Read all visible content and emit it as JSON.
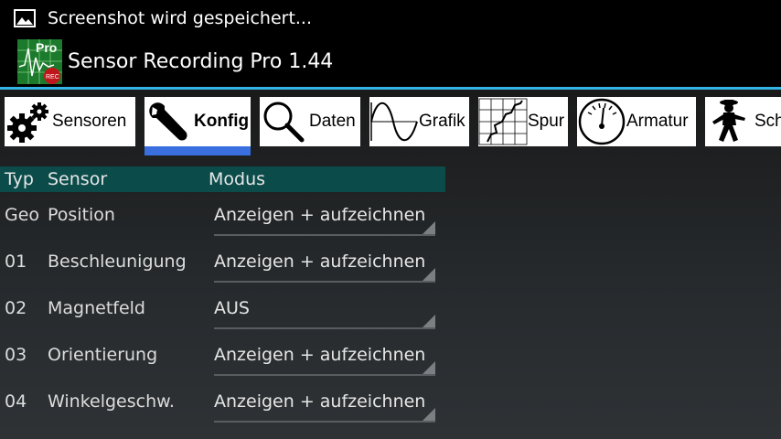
{
  "status_bar": {
    "notification": "Screenshot wird gespeichert..."
  },
  "app": {
    "title": "Sensor Recording Pro 1.44",
    "icon_text": "Pro",
    "icon_badge": "REC"
  },
  "tabs": [
    {
      "label": "Sensoren",
      "icon": "gears-icon"
    },
    {
      "label": "Konfig",
      "icon": "wrench-icon",
      "active": true
    },
    {
      "label": "Daten",
      "icon": "magnifier-icon"
    },
    {
      "label": "Grafik",
      "icon": "sine-wave-icon"
    },
    {
      "label": "Spur",
      "icon": "track-map-icon"
    },
    {
      "label": "Armatur",
      "icon": "gauge-icon"
    },
    {
      "label": "Sch",
      "icon": "walking-man-icon"
    }
  ],
  "table": {
    "headers": {
      "typ": "Typ",
      "sensor": "Sensor",
      "modus": "Modus"
    },
    "rows": [
      {
        "typ": "Geo",
        "sensor": "Position",
        "modus": "Anzeigen + aufzeichnen"
      },
      {
        "typ": "01",
        "sensor": "Beschleunigung",
        "modus": "Anzeigen + aufzeichnen"
      },
      {
        "typ": "02",
        "sensor": "Magnetfeld",
        "modus": "AUS"
      },
      {
        "typ": "03",
        "sensor": "Orientierung",
        "modus": "Anzeigen + aufzeichnen"
      },
      {
        "typ": "04",
        "sensor": "Winkelgeschw.",
        "modus": "Anzeigen + aufzeichnen"
      }
    ]
  },
  "colors": {
    "accent": "#33b5e5",
    "header_bg": "#0b4c4b",
    "tab_indicator": "#3a6fe0"
  }
}
